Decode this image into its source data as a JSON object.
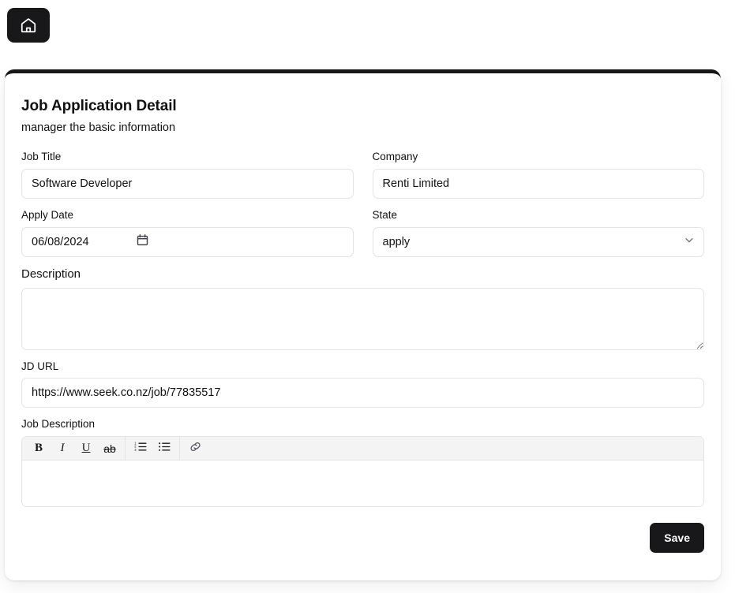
{
  "topbar": {
    "home_icon": "home-icon"
  },
  "card": {
    "title": "Job Application Detail",
    "subtitle": "manager the basic information"
  },
  "form": {
    "job_title": {
      "label": "Job Title",
      "value": "Software Developer",
      "placeholder": ""
    },
    "company": {
      "label": "Company",
      "value": "Renti Limited",
      "placeholder": ""
    },
    "apply_date": {
      "label": "Apply Date",
      "value": "2024-06-08",
      "display_value": "06/08/2024",
      "icon": "calendar-icon"
    },
    "state": {
      "label": "State",
      "value": "apply",
      "options": [
        "apply"
      ],
      "icon": "chevron-down-icon"
    },
    "description": {
      "label": "Description",
      "value": "",
      "placeholder": ""
    },
    "jd_url": {
      "label": "JD URL",
      "value": "https://www.seek.co.nz/job/77835517",
      "placeholder": ""
    },
    "job_description": {
      "label": "Job Description",
      "value": "",
      "toolbar": [
        {
          "name": "bold-button",
          "glyph": "B",
          "style": "bold"
        },
        {
          "name": "italic-button",
          "glyph": "I",
          "style": "italic"
        },
        {
          "name": "underline-button",
          "glyph": "U",
          "style": "underline"
        },
        {
          "name": "strikethrough-button",
          "glyph": "ab",
          "style": "strike"
        },
        {
          "name": "ordered-list-button",
          "glyph": "",
          "style": "icon-ol"
        },
        {
          "name": "unordered-list-button",
          "glyph": "",
          "style": "icon-ul"
        },
        {
          "name": "link-button",
          "glyph": "",
          "style": "icon-link"
        }
      ]
    }
  },
  "footer": {
    "save_label": "Save"
  },
  "colors": {
    "accent": "#18181b",
    "border": "#e4e4e7",
    "toolbar_bg": "#f4f4f5",
    "page_bg": "#ffffff"
  }
}
